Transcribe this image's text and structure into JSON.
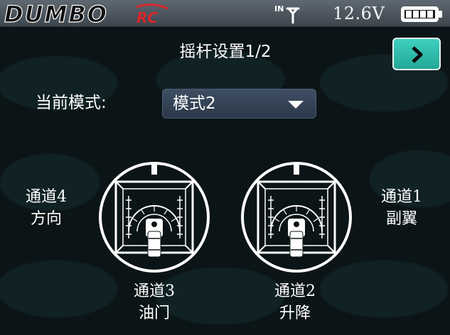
{
  "header": {
    "logo_text": "DUMBO",
    "logo_suffix": "RC",
    "voltage": "12.6V",
    "battery_level": 1.0
  },
  "page": {
    "title": "摇杆设置1/2"
  },
  "mode": {
    "label": "当前模式:",
    "value": "模式2"
  },
  "channels": {
    "left_horizontal": {
      "line1": "通道4",
      "line2": "方向"
    },
    "right_horizontal": {
      "line1": "通道1",
      "line2": "副翼"
    },
    "left_vertical": {
      "line1": "通道3",
      "line2": "油门"
    },
    "right_vertical": {
      "line1": "通道2",
      "line2": "升降"
    }
  },
  "colors": {
    "accent": "#2fbcaa",
    "logo_red": "#d8262b",
    "background": "#0b1416"
  }
}
